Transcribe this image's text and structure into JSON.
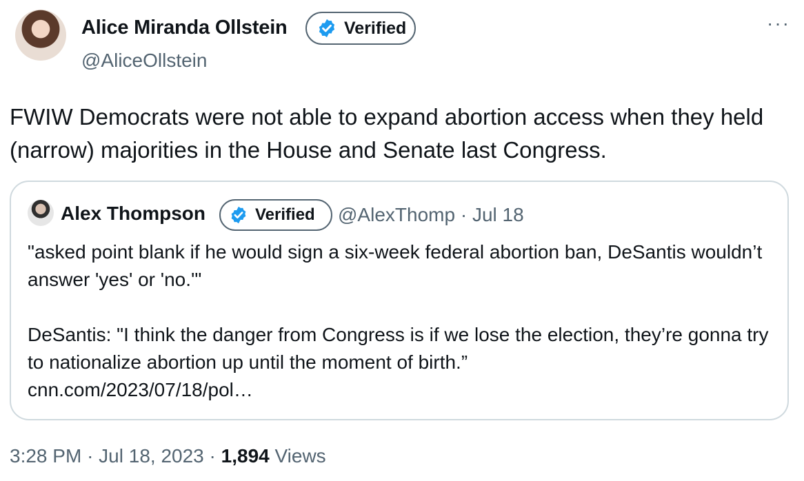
{
  "author": {
    "name": "Alice Miranda Ollstein",
    "verified_label": "Verified",
    "handle": "@AliceOllstein"
  },
  "more_label": "···",
  "tweet_text": "FWIW Democrats were not able to expand abortion access when they held (narrow) majorities in the House and Senate last Congress.",
  "quoted": {
    "name": "Alex Thompson",
    "verified_label": "Verified",
    "handle": "@AlexThomp",
    "date": "Jul 18",
    "text": "\"asked point blank if he would sign a six-week federal abortion ban, DeSantis wouldn’t answer 'yes' or 'no.'\"\n\nDeSantis: \"I think the danger from Congress is if we lose the election, they’re gonna try to nationalize abortion up until the moment of birth.”\ncnn.com/2023/07/18/pol…"
  },
  "meta": {
    "time": "3:28 PM",
    "date": "Jul 18, 2023",
    "views_count": "1,894",
    "views_label": "Views"
  },
  "colors": {
    "verified_blue": "#1d9bf0",
    "secondary_text": "#536471",
    "border": "#cfd9de"
  }
}
